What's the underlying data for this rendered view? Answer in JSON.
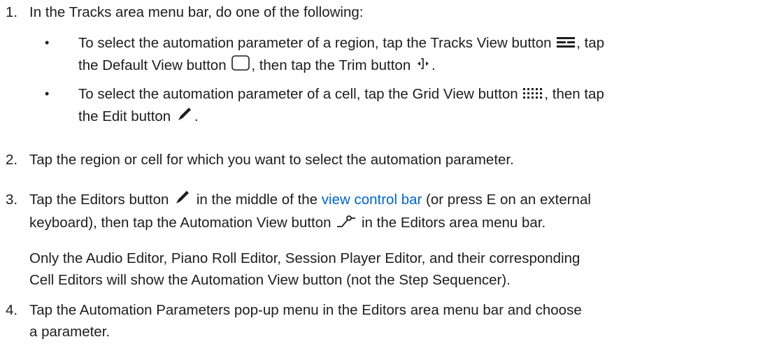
{
  "steps": [
    {
      "num": "1.",
      "text": "In the Tracks area menu bar, do one of the following:",
      "bullets": [
        {
          "l1a": "To select the automation parameter of a region, tap the Tracks View button",
          "l1b": ", tap",
          "l2a": "the Default View button",
          "l2b": ", then tap the Trim button",
          "l2c": "."
        },
        {
          "l1a": "To select the automation parameter of a cell, tap the Grid View button",
          "l1b": ", then tap",
          "l2a": "the Edit button",
          "l2b": "."
        }
      ]
    },
    {
      "num": "2.",
      "text": "Tap the region or cell for which you want to select the automation parameter."
    },
    {
      "num": "3.",
      "l1a": "Tap the Editors button",
      "l1b": "in the middle of the",
      "link": "view control bar",
      "l1c": "(or press E on an external",
      "l2a": "keyboard), then tap the Automation View button",
      "l2b": "in the Editors area menu bar.",
      "note1": "Only the Audio Editor, Piano Roll Editor, Session Player Editor, and their corresponding",
      "note2": "Cell Editors will show the Automation View button (not the Step Sequencer)."
    },
    {
      "num": "4.",
      "l1": "Tap the Automation Parameters pop-up menu in the Editors area menu bar and choose",
      "l2": "a parameter."
    }
  ],
  "link_color": "#0066cc",
  "icons": [
    "tracks-view-icon",
    "default-view-icon",
    "trim-icon",
    "grid-view-icon",
    "edit-icon",
    "editors-icon",
    "automation-view-icon"
  ]
}
